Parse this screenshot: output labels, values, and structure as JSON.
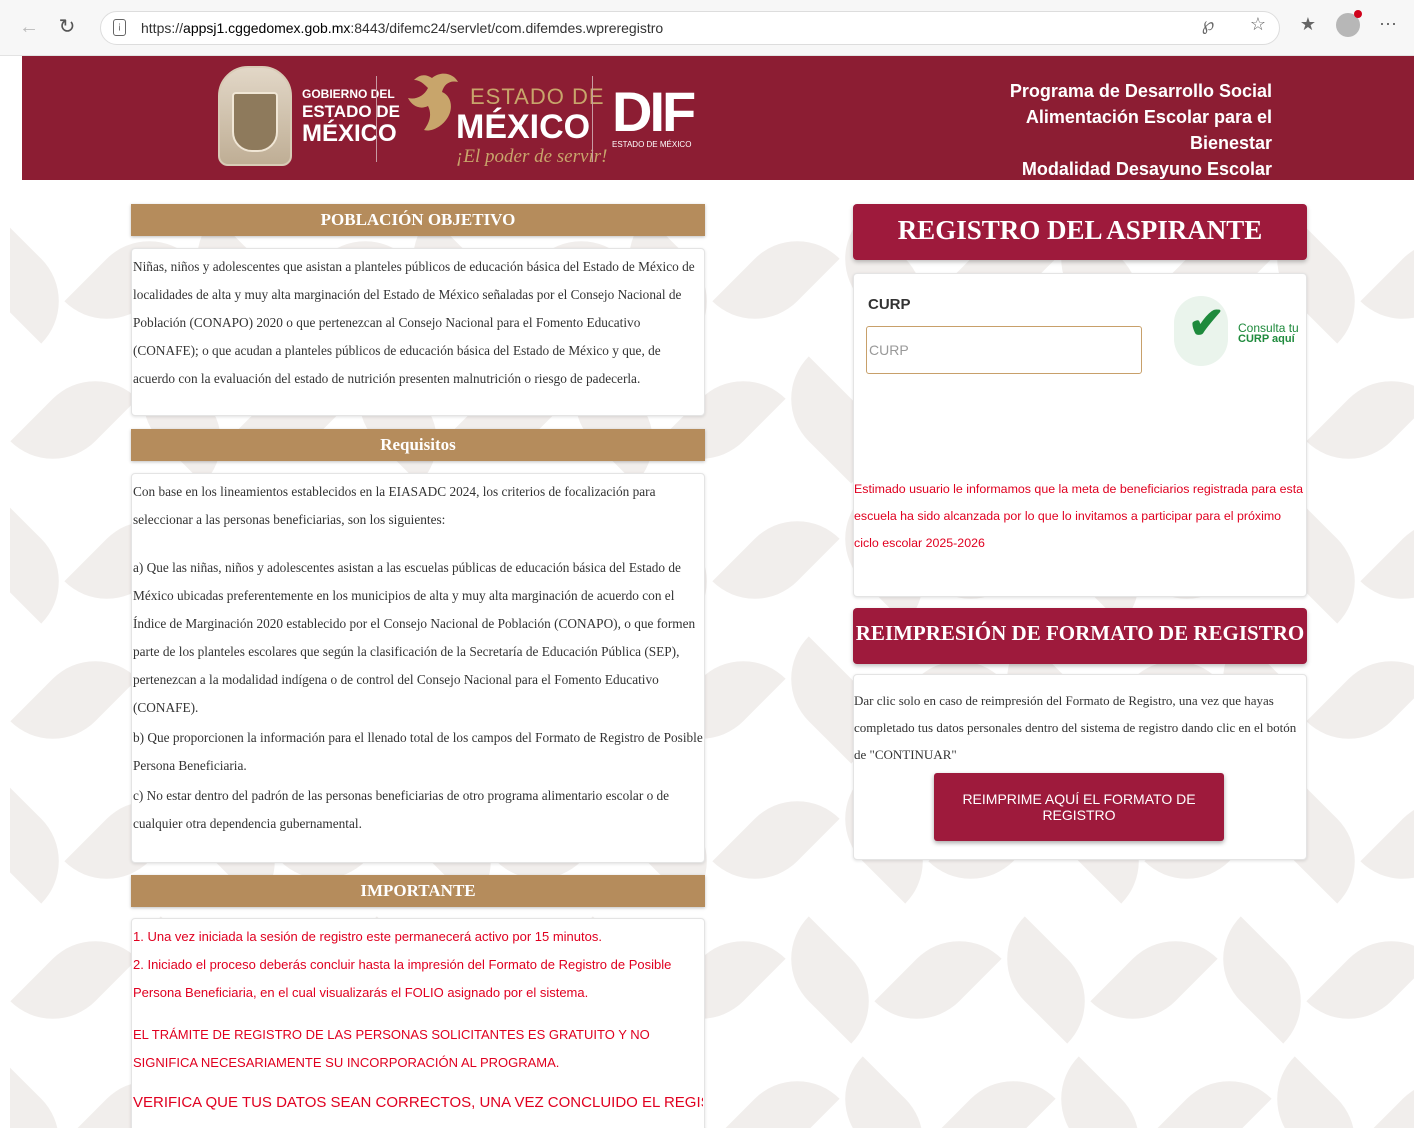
{
  "browser": {
    "url_prefix": "https://",
    "url_host": "appsj1.cggedomex.gob.mx",
    "url_rest": ":8443/difemc24/servlet/com.difemdes.wpreregistro",
    "back_icon": "←",
    "reload_icon": "↻",
    "lock_icon": "¡",
    "key_icon": "℘",
    "star_icon": "☆",
    "favorites_icon": "★",
    "more_icon": "⋯"
  },
  "header": {
    "gobierno_line1": "GOBIERNO DEL",
    "gobierno_line2": "ESTADO DE",
    "gobierno_line3": "MÉXICO",
    "edomex_line1": "ESTADO DE",
    "edomex_line2": "MÉXICO",
    "edomex_slogan": "¡El poder de servir!",
    "dif_logo": "DIF",
    "dif_sub": "ESTADO DE MÉXICO",
    "program_line1": "Programa de Desarrollo Social",
    "program_line2": "Alimentación Escolar para el Bienestar",
    "program_line3": "Modalidad Desayuno Escolar Caliente"
  },
  "poblacion": {
    "title": "POBLACIÓN OBJETIVO",
    "text": "Niñas, niños y adolescentes que asistan a planteles públicos de educación básica del Estado de México de localidades de alta y muy alta marginación del Estado de México señaladas por el Consejo Nacional de Población (CONAPO) 2020 o que pertenezcan al Consejo Nacional para el Fomento Educativo (CONAFE); o que acudan a planteles públicos de educación básica del Estado de México y que, de acuerdo con la evaluación del estado de nutrición presenten malnutrición o riesgo de padecerla."
  },
  "requisitos": {
    "title": "Requisitos",
    "intro": "Con base en los lineamientos establecidos en la EIASADC 2024, los criterios de focalización para seleccionar a las personas beneficiarias, son los siguientes:",
    "item_a": "a) Que las niñas, niños y adolescentes asistan a las escuelas públicas de educación básica del Estado de México ubicadas preferentemente en los municipios de alta y muy alta marginación de acuerdo con el Índice de Marginación 2020 establecido por el Consejo Nacional de Población (CONAPO), o que formen parte de los planteles escolares que según la clasificación de la Secretaría de Educación Pública (SEP), pertenezcan a la modalidad indígena o de control del Consejo Nacional para el Fomento Educativo (CONAFE).",
    "item_b": "b) Que proporcionen la información para el llenado total de los campos del Formato de Registro de Posible Persona Beneficiaria.",
    "item_c": "c) No estar dentro del padrón de las personas beneficiarias de otro programa alimentario escolar o de cualquier otra dependencia gubernamental."
  },
  "importante": {
    "title": "IMPORTANTE",
    "item1": "1. Una vez iniciada la sesión de registro este permanecerá activo por 15 minutos.",
    "item2": "2. Iniciado el proceso deberás concluir hasta la impresión del Formato de Registro de Posible Persona Beneficiaria, en el cual visualizarás el FOLIO asignado por el sistema.",
    "tramite": "EL TRÁMITE DE REGISTRO DE LAS PERSONAS SOLICITANTES ES GRATUITO Y NO SIGNIFICA NECESARIAMENTE SU INCORPORACIÓN AL PROGRAMA.",
    "verifica": "VERIFICA QUE TUS DATOS SEAN CORRECTOS, UNA VEZ CONCLUIDO EL REGISTRO NO"
  },
  "registro": {
    "title": "REGISTRO DEL ASPIRANTE",
    "curp_label": "CURP",
    "curp_placeholder": "CURP",
    "curp_value": "",
    "consulta_line1": "Consulta tu",
    "consulta_line2": "CURP aquí",
    "notice": "Estimado usuario le informamos que la meta de beneficiarios registrada para esta escuela ha sido alcanzada por lo que lo invitamos a participar para el próximo ciclo escolar 2025-2026"
  },
  "reimpresion": {
    "title": "REIMPRESIÓN DE FORMATO DE REGISTRO",
    "text": "Dar clic solo en caso de reimpresión del Formato de Registro, una vez que hayas completado tus datos personales dentro del sistema de registro dando clic en el botón de \"CONTINUAR\"",
    "button_label": "REIMPRIME AQUÍ EL FORMATO DE REGISTRO"
  },
  "colors": {
    "header_bg": "#8c1d33",
    "section_bar": "#b58c5c",
    "accent": "#9e1a3c",
    "alert_text": "#e00020"
  }
}
